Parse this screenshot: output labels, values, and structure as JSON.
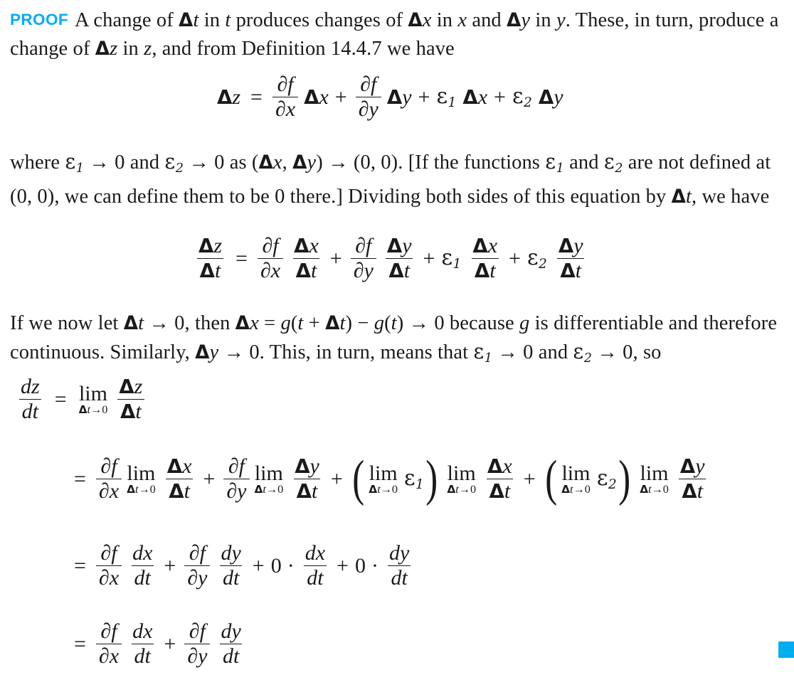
{
  "document": {
    "type": "textbook-proof",
    "background_color": "#ffffff",
    "text_color": "#1a1a18",
    "accent_color": "#00aeef"
  },
  "proof": {
    "label": "PROOF",
    "paragraph_1": "A change of Δt in t produces changes of Δx in x and Δy in y. These, in turn, produce a change of Δz in z, and from Definition 14.4.7 we have",
    "paragraph_1_parts": {
      "a": "A change of ",
      "b": "Δt",
      "c": " in ",
      "d": "t",
      "e": " produces changes of ",
      "f": "Δx",
      "g": " in ",
      "h": "x",
      "i": " and ",
      "j": "Δy",
      "k": " in ",
      "l": "y",
      "m": ". These, in turn, produce a change of ",
      "n": "Δz",
      "o": " in ",
      "p": "z",
      "q": ", and from Definition 14.4.7 we have"
    },
    "reference": "Definition 14.4.7",
    "paragraph_2_parts": {
      "a": "where ",
      "b": "ε",
      "b_sub": "1",
      "c": " → 0 and ",
      "d": "ε",
      "d_sub": "2",
      "e": " → 0 as (",
      "f": "Δx",
      "g": ", ",
      "h": "Δy",
      "i": ") → (0, 0). [If the functions ",
      "j": "ε",
      "j_sub": "1",
      "k": " and ",
      "l": "ε",
      "l_sub": "2",
      "m": " are not defined at (0, 0), we can define them to be 0 there.] Dividing both sides of this equation by ",
      "n": "Δt",
      "o": ", we have"
    },
    "paragraph_3_parts": {
      "a": "If we now let ",
      "b": "Δt",
      "c": " → 0, then ",
      "d": "Δx",
      "e": " = ",
      "f": "g",
      "g": "(",
      "h": "t",
      "i": " + ",
      "j": "Δt",
      "k": ") − ",
      "l": "g",
      "m": "(",
      "n": "t",
      "o": ") → 0 because ",
      "p": "g",
      "q": " is differentiable and therefore continuous. Similarly, ",
      "r": "Δy",
      "s": " → 0. This, in turn, means that ",
      "t": "ε",
      "t_sub": "1",
      "u": " → 0 and ",
      "v": "ε",
      "v_sub": "2",
      "w": " → 0, so"
    },
    "qed_marker": "■"
  },
  "symbols": {
    "delta": "Δ",
    "epsilon": "ε",
    "partial": "∂",
    "equals": "=",
    "plus": "+",
    "cdot": "·",
    "arrow": "→",
    "lim": "lim",
    "zero": "0",
    "paren_open": "(",
    "paren_close": ")",
    "sub_1": "1",
    "sub_2": "2",
    "f": "f",
    "x": "x",
    "y": "y",
    "z": "z",
    "t": "t",
    "d": "d",
    "lim_sub_text": "Δ0"
  },
  "equations": {
    "eq1": {
      "id": "delta-z-expansion",
      "latex": "\\Delta z = \\frac{\\partial f}{\\partial x}\\Delta x + \\frac{\\partial f}{\\partial y}\\Delta y + \\varepsilon_1 \\Delta x + \\varepsilon_2 \\Delta y",
      "plain": "Δz = (∂f/∂x)Δx + (∂f/∂y)Δy + ε₁Δx + ε₂Δy"
    },
    "eq2": {
      "id": "divided-by-delta-t",
      "latex": "\\frac{\\Delta z}{\\Delta t} = \\frac{\\partial f}{\\partial x}\\frac{\\Delta x}{\\Delta t} + \\frac{\\partial f}{\\partial y}\\frac{\\Delta y}{\\Delta t} + \\varepsilon_1 \\frac{\\Delta x}{\\Delta t} + \\varepsilon_2 \\frac{\\Delta y}{\\Delta t}",
      "plain": "Δz/Δt = (∂f/∂x)(Δx/Δt) + (∂f/∂y)(Δy/Δt) + ε₁(Δx/Δt) + ε₂(Δy/Δt)"
    },
    "eq3": {
      "id": "dz-dt-limit",
      "latex": "\\frac{dz}{dt} = \\lim_{\\Delta t \\to 0} \\frac{\\Delta z}{\\Delta t}",
      "plain": "dz/dt = lim(Δt→0) Δz/Δt"
    },
    "eq4": {
      "id": "limit-distributed",
      "latex": "= \\frac{\\partial f}{\\partial x}\\lim_{\\Delta t \\to 0}\\frac{\\Delta x}{\\Delta t} + \\frac{\\partial f}{\\partial y}\\lim_{\\Delta t \\to 0}\\frac{\\Delta y}{\\Delta t} + \\left(\\lim_{\\Delta t \\to 0}\\varepsilon_1\\right)\\lim_{\\Delta t \\to 0}\\frac{\\Delta x}{\\Delta t} + \\left(\\lim_{\\Delta t \\to 0}\\varepsilon_2\\right)\\lim_{\\Delta t \\to 0}\\frac{\\Delta y}{\\Delta t}",
      "plain": "= (∂f/∂x)lim(Δx/Δt) + (∂f/∂y)lim(Δy/Δt) + (lim ε₁)lim(Δx/Δt) + (lim ε₂)lim(Δy/Δt)"
    },
    "eq5": {
      "id": "with-zeros",
      "latex": "= \\frac{\\partial f}{\\partial x}\\frac{dx}{dt} + \\frac{\\partial f}{\\partial y}\\frac{dy}{dt} + 0 \\cdot \\frac{dx}{dt} + 0 \\cdot \\frac{dy}{dt}",
      "plain": "= (∂f/∂x)(dx/dt) + (∂f/∂y)(dy/dt) + 0·(dx/dt) + 0·(dy/dt)"
    },
    "eq6": {
      "id": "chain-rule-result",
      "latex": "= \\frac{\\partial f}{\\partial x}\\frac{dx}{dt} + \\frac{\\partial f}{\\partial y}\\frac{dy}{dt}",
      "plain": "= (∂f/∂x)(dx/dt) + (∂f/∂y)(dy/dt)"
    }
  }
}
